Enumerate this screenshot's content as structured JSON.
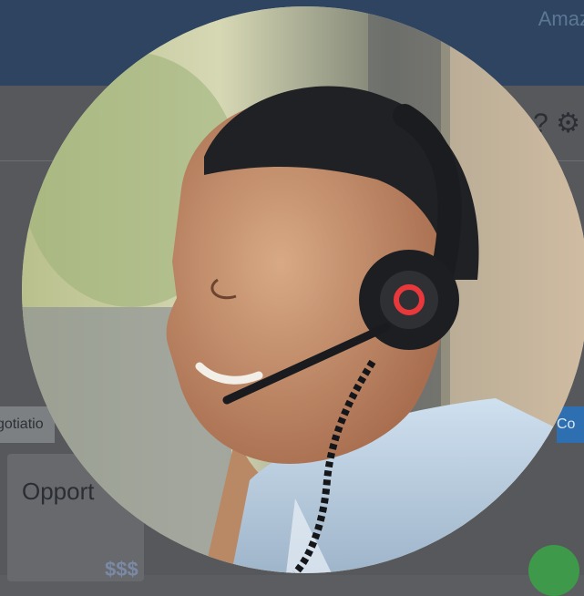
{
  "app": {
    "brand": "Amaz",
    "tab_left": "gotiatio",
    "tab_right": "Co",
    "card_title": "Opport",
    "money": "$$$"
  },
  "icons": {
    "settings": "gear-icon",
    "help": "help-icon",
    "success": "check-icon"
  },
  "colors": {
    "header": "#2e4460",
    "accent": "#2d6fb0",
    "success": "#3e9a4a",
    "headset_ring": "#e8383b"
  },
  "avatar": {
    "alt": "Support agent wearing headset"
  }
}
